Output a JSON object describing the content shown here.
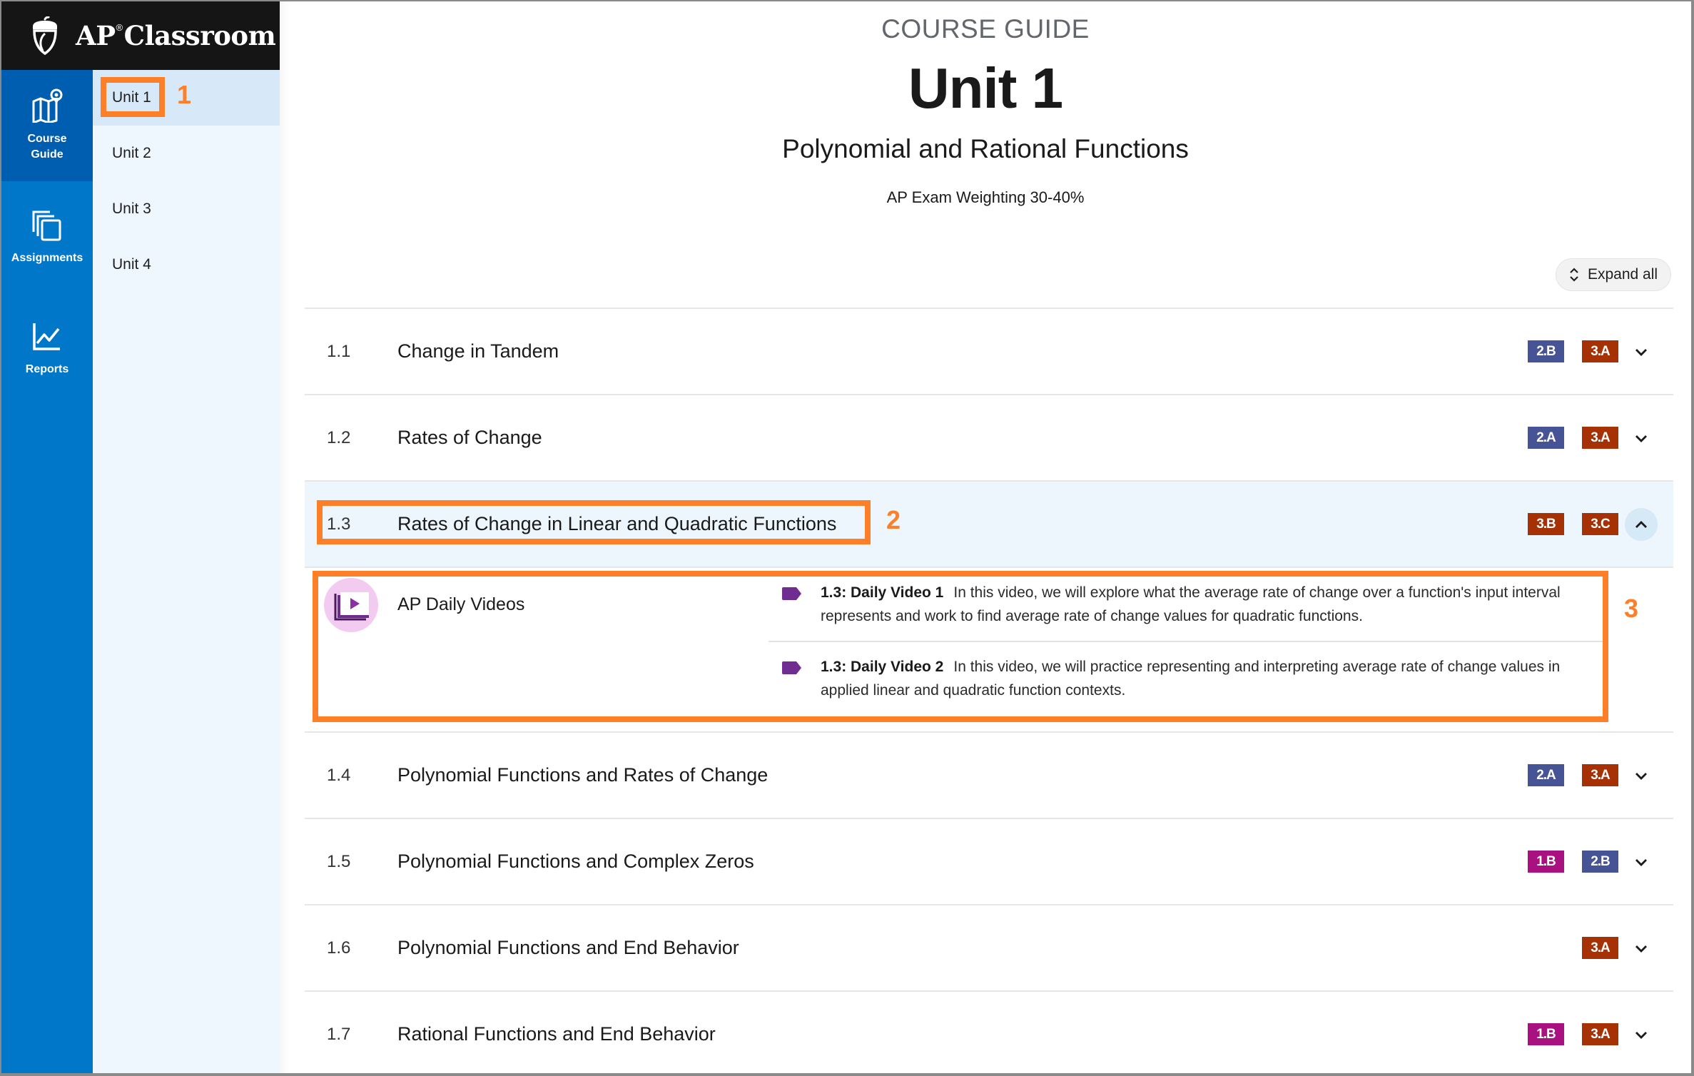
{
  "app": {
    "brand_name": "AP",
    "brand_mark": "®",
    "brand_product": "Classroom"
  },
  "rail": {
    "items": [
      {
        "label_line1": "Course",
        "label_line2": "Guide",
        "icon": "map-pin-icon",
        "active": true
      },
      {
        "label_line1": "Assignments",
        "label_line2": "",
        "icon": "stacked-pages-icon",
        "active": false
      },
      {
        "label_line1": "Reports",
        "label_line2": "",
        "icon": "line-chart-icon",
        "active": false
      }
    ]
  },
  "units": {
    "items": [
      {
        "label": "Unit 1",
        "active": true
      },
      {
        "label": "Unit 2",
        "active": false
      },
      {
        "label": "Unit 3",
        "active": false
      },
      {
        "label": "Unit 4",
        "active": false
      }
    ]
  },
  "header": {
    "eyebrow": "COURSE GUIDE",
    "title": "Unit 1",
    "subtitle": "Polynomial and Rational Functions",
    "weighting": "AP Exam Weighting 30-40%"
  },
  "toolbar": {
    "expand_all_label": "Expand all"
  },
  "colors": {
    "badge_1": "#a8117f",
    "badge_2": "#465496",
    "badge_3": "#a63105",
    "annotation": "#fd7f28",
    "rail_blue": "#0077c8",
    "rail_active": "#005eb0"
  },
  "topics": [
    {
      "num": "1.1",
      "title": "Change in Tandem",
      "badges": [
        "2.B",
        "3.A"
      ],
      "expanded": false
    },
    {
      "num": "1.2",
      "title": "Rates of Change",
      "badges": [
        "2.A",
        "3.A"
      ],
      "expanded": false
    },
    {
      "num": "1.3",
      "title": "Rates of Change in Linear and Quadratic Functions",
      "badges": [
        "3.B",
        "3.C"
      ],
      "expanded": true
    },
    {
      "num": "1.4",
      "title": "Polynomial Functions and Rates of Change",
      "badges": [
        "2.A",
        "3.A"
      ],
      "expanded": false
    },
    {
      "num": "1.5",
      "title": "Polynomial Functions and Complex Zeros",
      "badges": [
        "1.B",
        "2.B"
      ],
      "expanded": false
    },
    {
      "num": "1.6",
      "title": "Polynomial Functions and End Behavior",
      "badges": [
        "3.A"
      ],
      "expanded": false
    },
    {
      "num": "1.7",
      "title": "Rational Functions and End Behavior",
      "badges": [
        "1.B",
        "3.A"
      ],
      "expanded": false
    }
  ],
  "expanded_panel": {
    "label": "AP Daily Videos",
    "videos": [
      {
        "name": "1.3: Daily Video 1",
        "description": "In this video, we will explore what the average rate of change over a function's input interval represents and work to find average rate of change values for quadratic functions."
      },
      {
        "name": "1.3: Daily Video 2",
        "description": "In this video, we will practice representing and interpreting average rate of change values in applied linear and quadratic function contexts."
      }
    ]
  },
  "annotations": [
    "1",
    "2",
    "3"
  ]
}
